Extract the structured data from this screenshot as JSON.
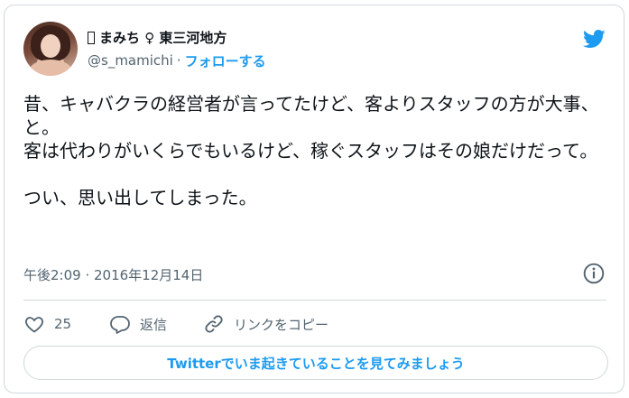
{
  "user": {
    "display_name": "まみち ♀ 東三河地方",
    "handle": "@s_mamichi",
    "separator": "·",
    "follow_label": "フォローする"
  },
  "tweet": {
    "text": "昔、キャバクラの経営者が言ってたけど、客よりスタッフの方が大事、と。\n客は代わりがいくらでもいるけど、稼ぐスタッフはその娘だけだって。\n\nつい、思い出してしまった。",
    "timestamp": "午後2:09 · 2016年12月14日"
  },
  "actions": {
    "like_count": "25",
    "reply_label": "返信",
    "copy_link_label": "リンクをコピー"
  },
  "cta": {
    "label": "Twitterでいま起きていることを見てみましょう"
  },
  "colors": {
    "accent": "#1d9bf0",
    "secondary_text": "#536471",
    "border": "#cfd9de"
  },
  "icons": [
    "avatar",
    "twitter-bird-icon",
    "info-icon",
    "heart-icon",
    "reply-bubble-icon",
    "link-icon"
  ]
}
